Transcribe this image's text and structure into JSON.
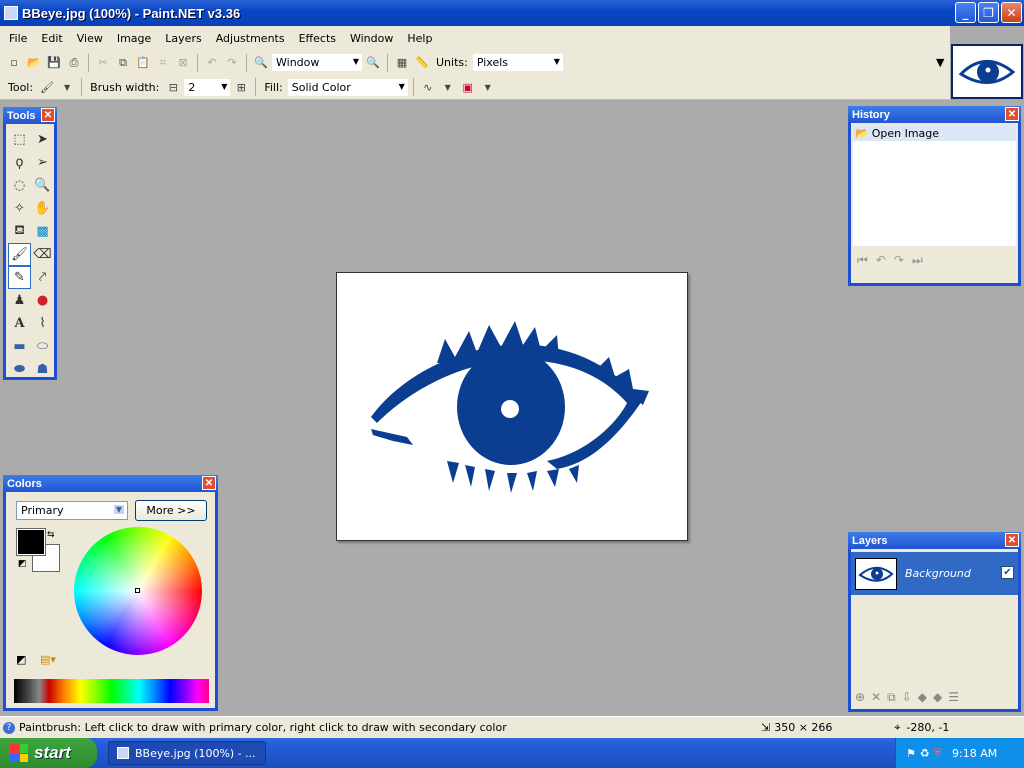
{
  "window": {
    "title": "BBeye.jpg (100%) - Paint.NET v3.36",
    "buttons": [
      "_",
      "❐",
      "✕"
    ]
  },
  "menu": [
    "File",
    "Edit",
    "View",
    "Image",
    "Layers",
    "Adjustments",
    "Effects",
    "Window",
    "Help"
  ],
  "toolbar": {
    "zoom_value": "Window",
    "units_label": "Units:",
    "units_value": "Pixels"
  },
  "toolbar2": {
    "tool_label": "Tool:",
    "brush_width_label": "Brush width:",
    "brush_width_value": "2",
    "fill_label": "Fill:",
    "fill_value": "Solid Color"
  },
  "tools_panel": {
    "title": "Tools"
  },
  "history_panel": {
    "title": "History",
    "items": [
      "Open Image"
    ]
  },
  "colors_panel": {
    "title": "Colors",
    "mode": "Primary",
    "more_button": "More >>",
    "primary_color": "#000000",
    "secondary_color": "#ffffff"
  },
  "layers_panel": {
    "title": "Layers",
    "layers": [
      {
        "name": "Background",
        "visible": true
      }
    ]
  },
  "status": {
    "hint": "Paintbrush: Left click to draw with primary color, right click to draw with secondary color",
    "image_size": "350 × 266",
    "cursor_pos": "-280, -1"
  },
  "taskbar": {
    "start_label": "start",
    "task_label": "BBeye.jpg (100%) - ...",
    "clock": "9:18 AM"
  },
  "colors": {
    "eye_blue": "#0b3d91",
    "title_blue": "#0a47c4"
  }
}
